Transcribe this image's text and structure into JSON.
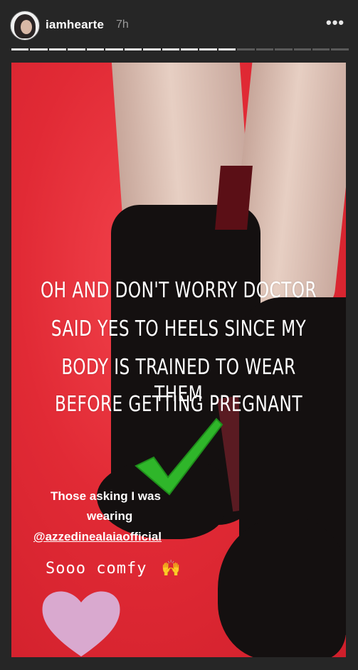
{
  "header": {
    "username": "iamhearte",
    "time": "7h",
    "menu_icon": "more-dots-icon",
    "progress": {
      "segments": 18,
      "completed": 12
    }
  },
  "story": {
    "main_text": [
      "OH AND DON'T WORRY DOCTOR",
      "SAID YES TO HEELS SINCE MY",
      "BODY IS TRAINED TO WEAR THEM",
      "BEFORE GETTING PREGNANT"
    ],
    "caption_line1": "Those asking I was",
    "caption_line2": "wearing",
    "mention": "@azzedinealaiaofficial",
    "comfy": "Sooo comfy",
    "emoji": "🙌",
    "stickers": [
      "checkmark-icon",
      "heart-icon"
    ],
    "colors": {
      "background": "#e12a35",
      "check": "#2fb62a",
      "heart": "#d9a9cf"
    }
  }
}
